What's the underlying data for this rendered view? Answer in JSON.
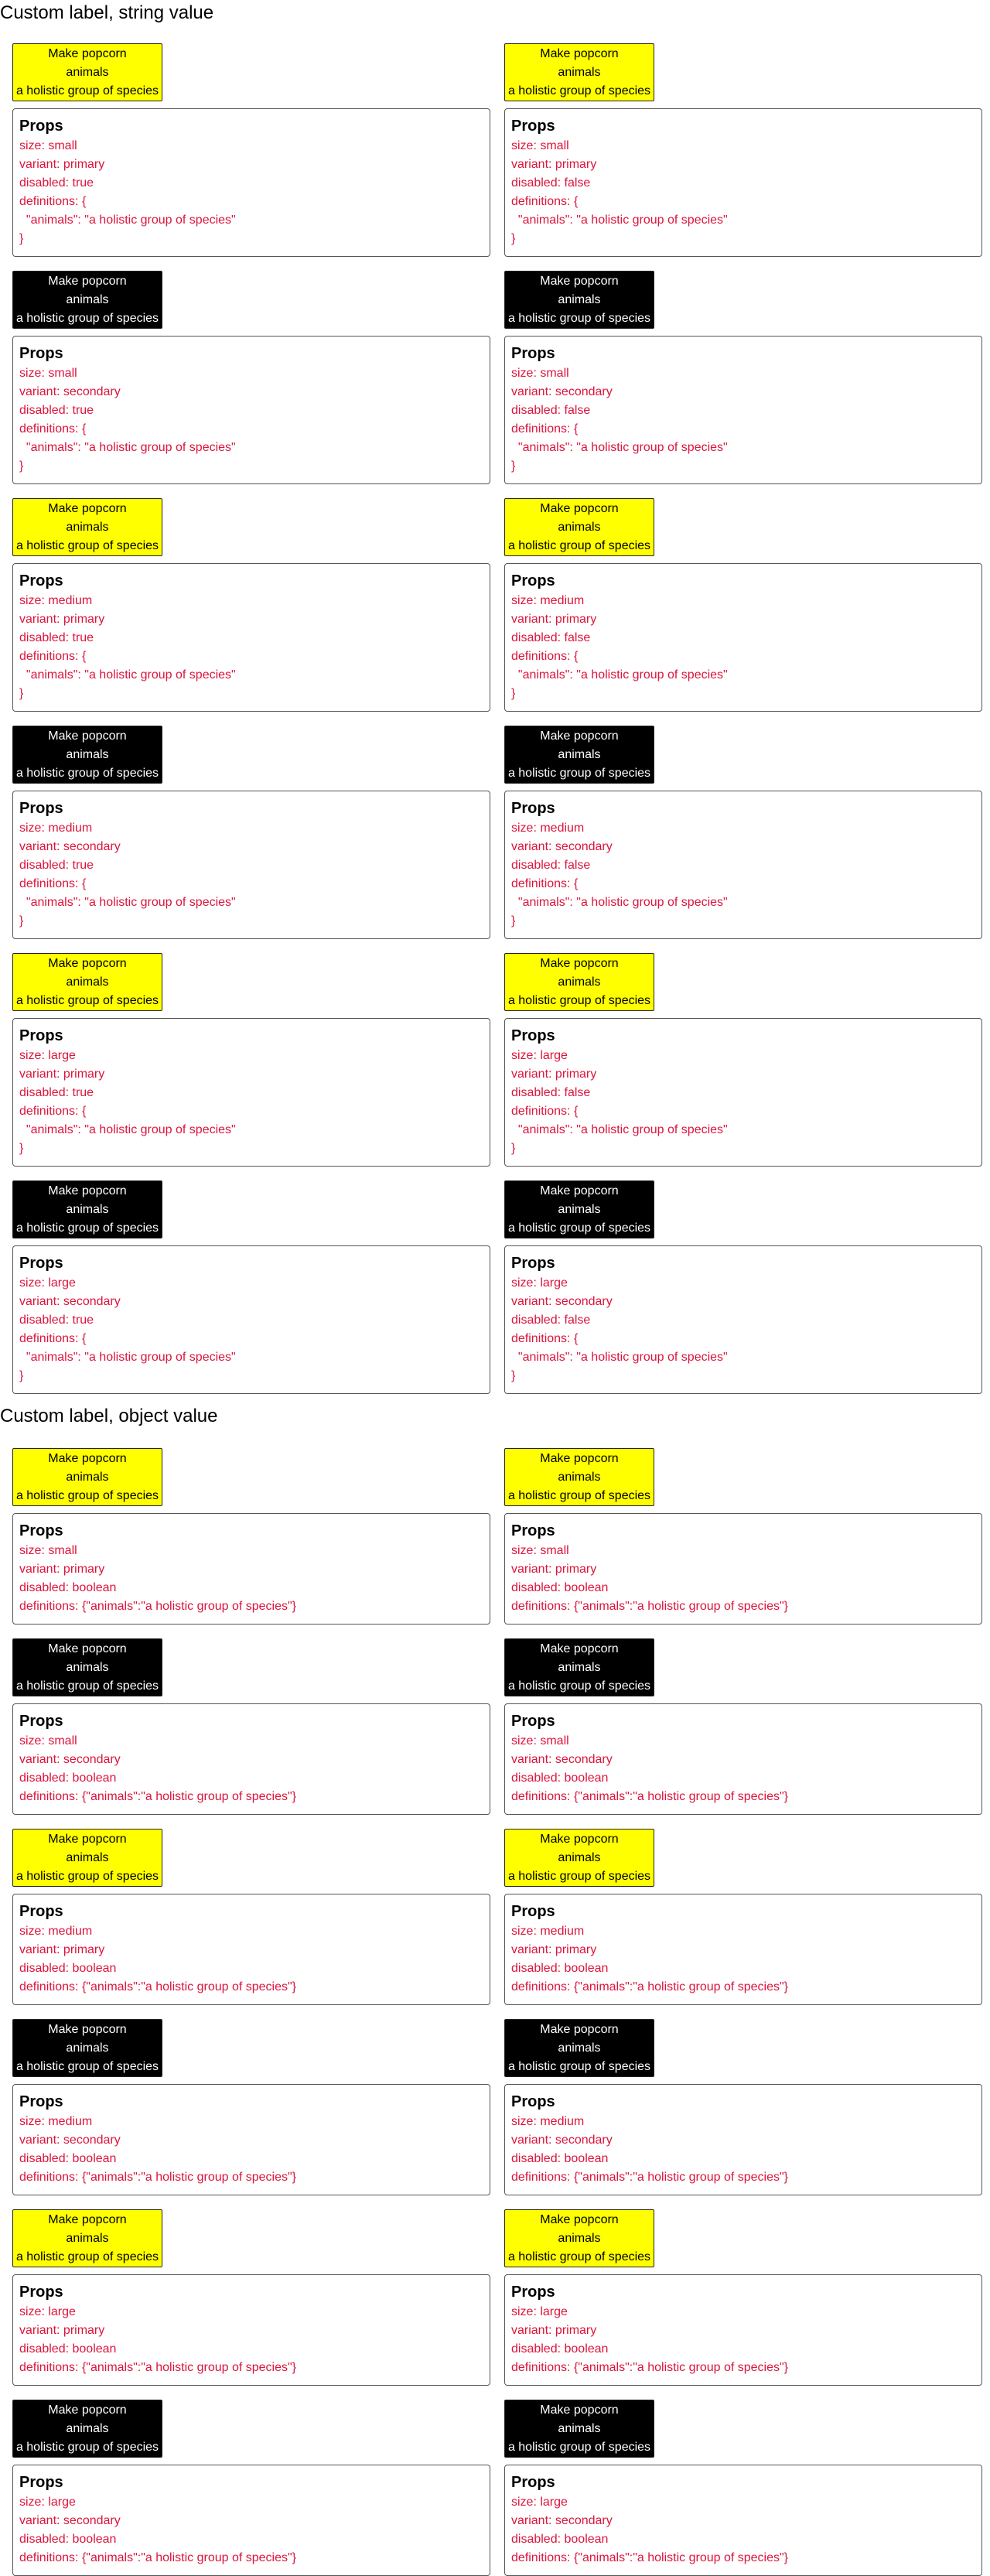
{
  "button": {
    "label": "Make popcorn",
    "term": "animals",
    "definition": "a holistic group of species"
  },
  "props_heading": "Props",
  "sections": [
    {
      "title": "Custom label, string value",
      "cells": [
        {
          "variant": "primary",
          "lines": [
            "size: small",
            "variant: primary",
            "disabled: true",
            "definitions: {",
            "  \"animals\": \"a holistic group of species\"",
            "}"
          ]
        },
        {
          "variant": "primary",
          "lines": [
            "size: small",
            "variant: primary",
            "disabled: false",
            "definitions: {",
            "  \"animals\": \"a holistic group of species\"",
            "}"
          ]
        },
        {
          "variant": "secondary",
          "lines": [
            "size: small",
            "variant: secondary",
            "disabled: true",
            "definitions: {",
            "  \"animals\": \"a holistic group of species\"",
            "}"
          ]
        },
        {
          "variant": "secondary",
          "lines": [
            "size: small",
            "variant: secondary",
            "disabled: false",
            "definitions: {",
            "  \"animals\": \"a holistic group of species\"",
            "}"
          ]
        },
        {
          "variant": "primary",
          "lines": [
            "size: medium",
            "variant: primary",
            "disabled: true",
            "definitions: {",
            "  \"animals\": \"a holistic group of species\"",
            "}"
          ]
        },
        {
          "variant": "primary",
          "lines": [
            "size: medium",
            "variant: primary",
            "disabled: false",
            "definitions: {",
            "  \"animals\": \"a holistic group of species\"",
            "}"
          ]
        },
        {
          "variant": "secondary",
          "lines": [
            "size: medium",
            "variant: secondary",
            "disabled: true",
            "definitions: {",
            "  \"animals\": \"a holistic group of species\"",
            "}"
          ]
        },
        {
          "variant": "secondary",
          "lines": [
            "size: medium",
            "variant: secondary",
            "disabled: false",
            "definitions: {",
            "  \"animals\": \"a holistic group of species\"",
            "}"
          ]
        },
        {
          "variant": "primary",
          "lines": [
            "size: large",
            "variant: primary",
            "disabled: true",
            "definitions: {",
            "  \"animals\": \"a holistic group of species\"",
            "}"
          ]
        },
        {
          "variant": "primary",
          "lines": [
            "size: large",
            "variant: primary",
            "disabled: false",
            "definitions: {",
            "  \"animals\": \"a holistic group of species\"",
            "}"
          ]
        },
        {
          "variant": "secondary",
          "lines": [
            "size: large",
            "variant: secondary",
            "disabled: true",
            "definitions: {",
            "  \"animals\": \"a holistic group of species\"",
            "}"
          ]
        },
        {
          "variant": "secondary",
          "lines": [
            "size: large",
            "variant: secondary",
            "disabled: false",
            "definitions: {",
            "  \"animals\": \"a holistic group of species\"",
            "}"
          ]
        }
      ]
    },
    {
      "title": "Custom label, object value",
      "cells": [
        {
          "variant": "primary",
          "lines": [
            "size: small",
            "variant: primary",
            "disabled: boolean",
            "definitions: {\"animals\":\"a holistic group of species\"}"
          ]
        },
        {
          "variant": "primary",
          "lines": [
            "size: small",
            "variant: primary",
            "disabled: boolean",
            "definitions: {\"animals\":\"a holistic group of species\"}"
          ]
        },
        {
          "variant": "secondary",
          "lines": [
            "size: small",
            "variant: secondary",
            "disabled: boolean",
            "definitions: {\"animals\":\"a holistic group of species\"}"
          ]
        },
        {
          "variant": "secondary",
          "lines": [
            "size: small",
            "variant: secondary",
            "disabled: boolean",
            "definitions: {\"animals\":\"a holistic group of species\"}"
          ]
        },
        {
          "variant": "primary",
          "lines": [
            "size: medium",
            "variant: primary",
            "disabled: boolean",
            "definitions: {\"animals\":\"a holistic group of species\"}"
          ]
        },
        {
          "variant": "primary",
          "lines": [
            "size: medium",
            "variant: primary",
            "disabled: boolean",
            "definitions: {\"animals\":\"a holistic group of species\"}"
          ]
        },
        {
          "variant": "secondary",
          "lines": [
            "size: medium",
            "variant: secondary",
            "disabled: boolean",
            "definitions: {\"animals\":\"a holistic group of species\"}"
          ]
        },
        {
          "variant": "secondary",
          "lines": [
            "size: medium",
            "variant: secondary",
            "disabled: boolean",
            "definitions: {\"animals\":\"a holistic group of species\"}"
          ]
        },
        {
          "variant": "primary",
          "lines": [
            "size: large",
            "variant: primary",
            "disabled: boolean",
            "definitions: {\"animals\":\"a holistic group of species\"}"
          ]
        },
        {
          "variant": "primary",
          "lines": [
            "size: large",
            "variant: primary",
            "disabled: boolean",
            "definitions: {\"animals\":\"a holistic group of species\"}"
          ]
        },
        {
          "variant": "secondary",
          "lines": [
            "size: large",
            "variant: secondary",
            "disabled: boolean",
            "definitions: {\"animals\":\"a holistic group of species\"}"
          ]
        },
        {
          "variant": "secondary",
          "lines": [
            "size: large",
            "variant: secondary",
            "disabled: boolean",
            "definitions: {\"animals\":\"a holistic group of species\"}"
          ]
        }
      ]
    }
  ],
  "colors": {
    "primary_button_bg": "#ffff00",
    "secondary_button_bg": "#000000",
    "prop_text": "#dc143c"
  }
}
